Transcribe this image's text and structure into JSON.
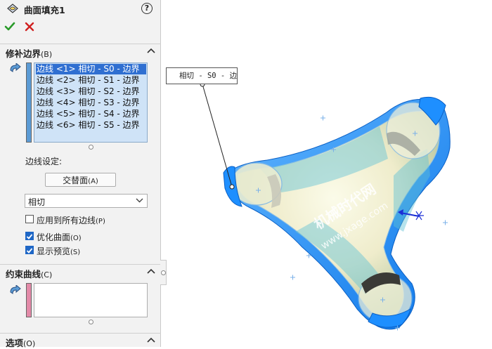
{
  "panel": {
    "title": "曲面填充1",
    "help_glyph": "?",
    "sections": {
      "patch_boundary": {
        "title": "修补边界",
        "shortcut": "(B)",
        "items": [
          "边线 <1> 相切 - S0 - 边界",
          "边线 <2> 相切 - S1 - 边界",
          "边线 <3> 相切 - S2 - 边界",
          "边线 <4> 相切 - S3 - 边界",
          "边线 <5> 相切 - S4 - 边界",
          "边线 <6> 相切 - S5 - 边界"
        ],
        "selected_index": 0
      },
      "edge_settings": {
        "label": "边线设定:",
        "alternate_face_button": "交替面",
        "alternate_face_shortcut": "(A)",
        "condition_value": "相切",
        "apply_all_label": "应用到所有边线",
        "apply_all_shortcut": "(P)",
        "apply_all_checked": false,
        "optimize_label": "优化曲面",
        "optimize_shortcut": "(O)",
        "optimize_checked": true,
        "preview_label": "显示预览",
        "preview_shortcut": "(S)",
        "preview_checked": true
      },
      "constraint_curves": {
        "title": "约束曲线",
        "shortcut": "(C)"
      },
      "options": {
        "title": "选项",
        "shortcut": "(O)"
      }
    }
  },
  "viewport": {
    "callout_text": "相切 - S0 - 边界",
    "watermark_cn": "机械时代网",
    "watermark_url": "www.jxage.com"
  },
  "colors": {
    "selection_blue": "#2f6fd1",
    "list_bg": "#cfe3f7",
    "surface_blue": "#1e8fff",
    "surface_yellow": "#f1eec8",
    "ok_green": "#2a9a2a",
    "cancel_red": "#d02020",
    "constraint_pink": "#e38aa8"
  },
  "icons": {
    "title": "surface-fill-icon",
    "help": "help-icon",
    "ok": "checkmark-icon",
    "cancel": "close-icon",
    "selection": "selection-arrows-icon",
    "collapse": "chevron-up-icon",
    "dropdown": "chevron-down-icon"
  }
}
